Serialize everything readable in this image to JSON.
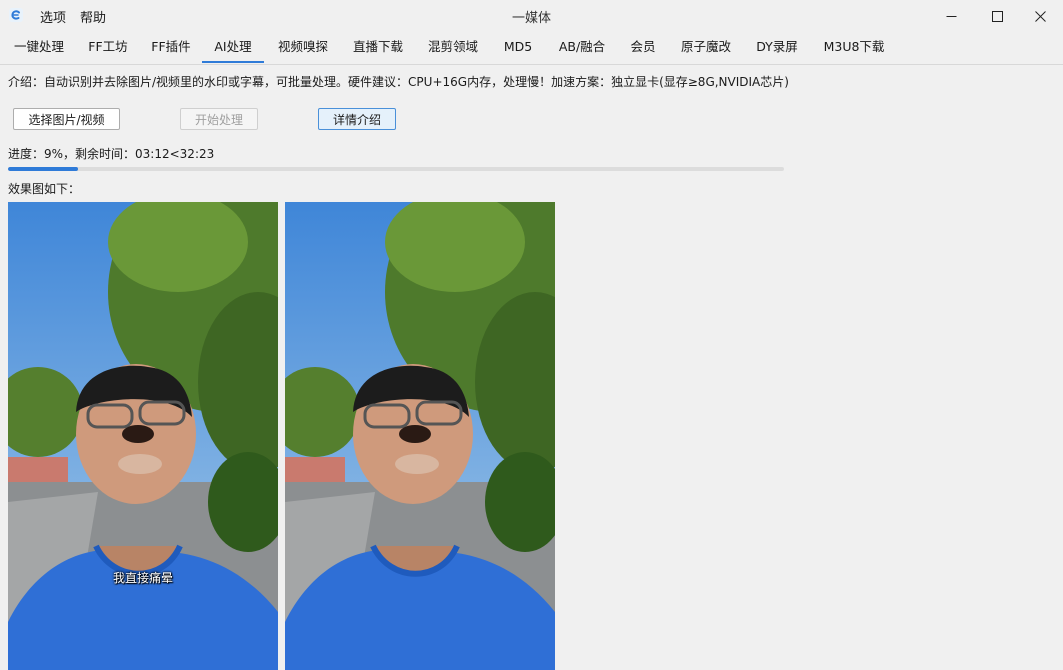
{
  "window": {
    "title": "一媒体",
    "menu": [
      "选项",
      "帮助"
    ]
  },
  "tabs": [
    {
      "label": "一键处理",
      "active": false
    },
    {
      "label": "FF工坊",
      "active": false
    },
    {
      "label": "FF插件",
      "active": false
    },
    {
      "label": "AI处理",
      "active": true
    },
    {
      "label": "视频嗅探",
      "active": false
    },
    {
      "label": "直播下载",
      "active": false
    },
    {
      "label": "混剪领域",
      "active": false
    },
    {
      "label": "MD5",
      "active": false
    },
    {
      "label": "AB/融合",
      "active": false
    },
    {
      "label": "会员",
      "active": false
    },
    {
      "label": "原子魔改",
      "active": false
    },
    {
      "label": "DY录屏",
      "active": false
    },
    {
      "label": "M3U8下载",
      "active": false
    }
  ],
  "main": {
    "intro": "介绍：自动识别并去除图片/视频里的水印或字幕，可批量处理。硬件建议：CPU+16G内存，处理慢！加速方案：独立显卡(显存≥8G,NVIDIA芯片)",
    "buttons": {
      "select": "选择图片/视频",
      "start": "开始处理",
      "details": "详情介绍"
    },
    "progress_text": "进度：9%，剩余时间：03:12<32:23",
    "progress_fraction": 0.09,
    "result_label": "效果图如下：",
    "preview_before_subtitle": "我直接痛晕"
  },
  "colors": {
    "accent": "#2f7bd8",
    "background": "#f0f0f0",
    "shirt": "#2f6fd6"
  },
  "icons": {
    "app": "app-logo-icon",
    "minimize": "minimize-icon",
    "maximize": "maximize-icon",
    "close": "close-icon"
  }
}
